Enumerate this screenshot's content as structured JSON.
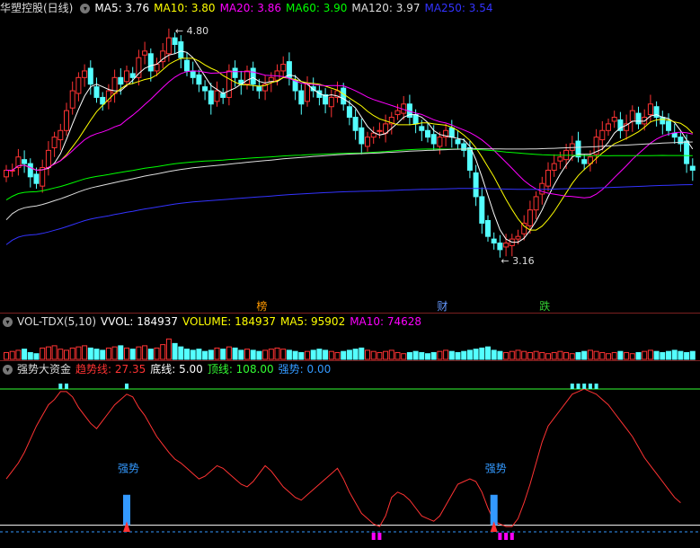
{
  "panels": {
    "main": {
      "title": "华塑控股(日线)",
      "ma": [
        {
          "label": "MA5: 3.76",
          "color": "#ffffff"
        },
        {
          "label": "MA10: 3.80",
          "color": "#ffff00"
        },
        {
          "label": "MA20: 3.86",
          "color": "#ff00ff"
        },
        {
          "label": "MA60: 3.90",
          "color": "#00ff00"
        },
        {
          "label": "MA120: 3.97",
          "color": "#dddddd"
        },
        {
          "label": "MA250: 3.54",
          "color": "#3333ff"
        }
      ],
      "high_label": "4.80",
      "low_label": "3.16",
      "markers": [
        {
          "text": "榜",
          "color": "#ff9900"
        },
        {
          "text": "财",
          "color": "#6699ff"
        },
        {
          "text": "跌",
          "color": "#33cc33"
        }
      ]
    },
    "volume": {
      "title": "VOL-TDX(5,10)",
      "items": [
        {
          "label": "VVOL: 184937",
          "color": "#ffffff"
        },
        {
          "label": "VOLUME: 184937",
          "color": "#ffff00"
        },
        {
          "label": "MA5: 95902",
          "color": "#ffff00"
        },
        {
          "label": "MA10: 74628",
          "color": "#ff00ff"
        }
      ]
    },
    "indicator": {
      "title": "强势大资金",
      "items": [
        {
          "label": "趋势线: 27.35",
          "color": "#ff3333"
        },
        {
          "label": "底线: 5.00",
          "color": "#ffffff"
        },
        {
          "label": "顶线: 108.00",
          "color": "#33ff33"
        },
        {
          "label": "强势: 0.00",
          "color": "#3399ff"
        }
      ],
      "signal_label": "强势"
    }
  },
  "chart_data": [
    {
      "type": "candlestick",
      "title": "华塑控股(日线)",
      "high": 4.8,
      "low": 3.16,
      "ma_latest": {
        "MA5": 3.76,
        "MA10": 3.8,
        "MA20": 3.86,
        "MA60": 3.9,
        "MA120": 3.97,
        "MA250": 3.54
      },
      "close": [
        3.8,
        3.8,
        3.9,
        3.85,
        3.75,
        3.7,
        3.82,
        3.95,
        4.05,
        4.1,
        4.25,
        4.4,
        4.5,
        4.55,
        4.45,
        4.35,
        4.3,
        4.4,
        4.5,
        4.45,
        4.55,
        4.5,
        4.65,
        4.7,
        4.55,
        4.6,
        4.7,
        4.8,
        4.75,
        4.65,
        4.55,
        4.5,
        4.45,
        4.4,
        4.3,
        4.4,
        4.35,
        4.55,
        4.5,
        4.45,
        4.55,
        4.45,
        4.4,
        4.45,
        4.5,
        4.55,
        4.6,
        4.5,
        4.4,
        4.3,
        4.45,
        4.4,
        4.35,
        4.3,
        4.35,
        4.4,
        4.3,
        4.2,
        4.1,
        4.0,
        4.05,
        4.08,
        4.1,
        4.15,
        4.2,
        4.25,
        4.3,
        4.2,
        4.15,
        4.1,
        4.05,
        4.0,
        4.05,
        4.1,
        4.05,
        4.0,
        3.95,
        3.8,
        3.6,
        3.4,
        3.3,
        3.25,
        3.2,
        3.25,
        3.28,
        3.3,
        3.4,
        3.5,
        3.6,
        3.7,
        3.8,
        3.85,
        3.9,
        3.95,
        4.0,
        3.9,
        3.85,
        3.9,
        4.05,
        4.1,
        4.15,
        4.2,
        4.1,
        4.15,
        4.25,
        4.15,
        4.2,
        4.3,
        4.2,
        4.15,
        4.1,
        4.05,
        4.0,
        3.85,
        3.8
      ],
      "vol_scale": [
        0.3,
        0.35,
        0.4,
        0.45,
        0.3,
        0.25,
        0.5,
        0.55,
        0.6,
        0.45,
        0.4,
        0.5,
        0.55,
        0.6,
        0.5,
        0.45,
        0.4,
        0.5,
        0.55,
        0.6,
        0.5,
        0.45,
        0.55,
        0.6,
        0.45,
        0.5,
        0.65,
        0.9,
        0.7,
        0.55,
        0.45,
        0.4,
        0.45,
        0.35,
        0.4,
        0.5,
        0.45,
        0.55,
        0.5,
        0.4,
        0.45,
        0.4,
        0.35,
        0.4,
        0.45,
        0.5,
        0.45,
        0.4,
        0.35,
        0.3,
        0.35,
        0.4,
        0.45,
        0.4,
        0.35,
        0.3,
        0.35,
        0.4,
        0.45,
        0.5,
        0.4,
        0.35,
        0.3,
        0.35,
        0.4,
        0.3,
        0.25,
        0.3,
        0.35,
        0.3,
        0.25,
        0.3,
        0.35,
        0.4,
        0.35,
        0.3,
        0.35,
        0.4,
        0.45,
        0.5,
        0.55,
        0.4,
        0.35,
        0.3,
        0.35,
        0.4,
        0.35,
        0.3,
        0.35,
        0.3,
        0.25,
        0.3,
        0.35,
        0.3,
        0.25,
        0.3,
        0.35,
        0.4,
        0.35,
        0.3,
        0.25,
        0.3,
        0.35,
        0.3,
        0.25,
        0.3,
        0.35,
        0.4,
        0.35,
        0.3,
        0.35,
        0.4,
        0.35,
        0.3,
        0.35
      ],
      "trend_line": [
        40,
        46,
        52,
        60,
        70,
        80,
        88,
        96,
        100,
        106,
        106,
        102,
        94,
        88,
        82,
        78,
        84,
        90,
        96,
        100,
        104,
        102,
        94,
        88,
        80,
        72,
        66,
        60,
        55,
        52,
        48,
        44,
        40,
        42,
        46,
        50,
        48,
        44,
        40,
        36,
        34,
        38,
        44,
        50,
        46,
        40,
        34,
        30,
        26,
        24,
        28,
        32,
        36,
        40,
        44,
        48,
        40,
        30,
        22,
        14,
        10,
        6,
        4,
        12,
        26,
        30,
        28,
        24,
        18,
        12,
        10,
        8,
        12,
        20,
        28,
        36,
        38,
        40,
        38,
        30,
        18,
        8,
        6,
        4,
        4,
        10,
        22,
        36,
        52,
        68,
        80,
        86,
        92,
        98,
        104,
        106,
        108,
        106,
        104,
        100,
        96,
        90,
        84,
        78,
        72,
        64,
        56,
        50,
        44,
        38,
        32,
        26,
        22
      ]
    }
  ]
}
